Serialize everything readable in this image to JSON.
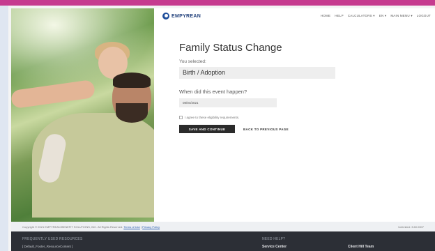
{
  "header": {
    "logo_text": "EMPYREAN",
    "nav": [
      "HOME",
      "HELP",
      "CALCULATORS ▾",
      "EN ▾",
      "MAIN MENU ▾",
      "LOGOUT"
    ]
  },
  "form": {
    "title": "Family Status Change",
    "selected_label": "You selected:",
    "selected_value": "Birth / Adoption",
    "question": "When did this event happen?",
    "date_value": "08/04/2021",
    "agree_text": "I agree to these eligibility requirements.",
    "primary_button": "SAVE AND CONTINUE",
    "back_link": "BACK TO PREVIOUS PAGE"
  },
  "footer_meta": {
    "copyright_prefix": "Copyright © 2021 EMPYREAN BENEFIT SOLUTIONS, INC. All Rights Reserved.",
    "terms": "Terms of Use",
    "separator": "|",
    "privacy": "Privacy Policy",
    "version": "Unlimited: 3.60.0007"
  },
  "footer": {
    "resources_heading": "FREQUENTLY USED RESOURCES",
    "resources_item": "[ Default_Footer_ResourceContent ]",
    "help_heading": "NEED HELP?",
    "service_center": "Service Center",
    "client_team": "Client Hill Team"
  },
  "colors": {
    "accent_top": "#c63b8f",
    "brand": "#1f4f9c",
    "primary_button": "#2b2b2b",
    "footer_bg": "#2c2f36"
  }
}
